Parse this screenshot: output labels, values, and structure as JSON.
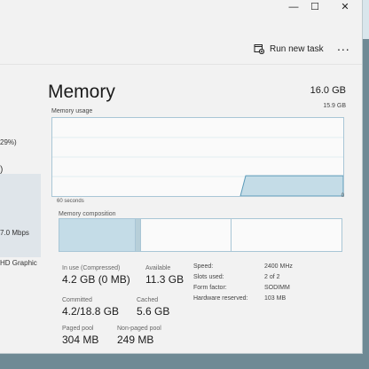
{
  "window": {
    "controls": {
      "minimize": "—",
      "maximize": "☐",
      "close": "✕"
    }
  },
  "toolbar": {
    "run_new_task": "Run new task",
    "more": "..."
  },
  "sidebar": {
    "items": [
      {
        "label": "29%)"
      },
      {
        "label": ")"
      },
      {
        "label": "7.0 Mbps"
      },
      {
        "label": "HD Graphic"
      }
    ]
  },
  "memory": {
    "title": "Memory",
    "total": "16.0 GB",
    "usage_graph": {
      "label": "Memory usage",
      "max_label": "15.9 GB",
      "time_left_label": "60 seconds",
      "time_right_label": "0",
      "recent_usage_fraction": 0.26
    },
    "composition": {
      "label": "Memory composition",
      "in_use_fraction": 0.27,
      "modified_fraction": 0.02,
      "standby_fraction": 0.32,
      "free_fraction": 0.39
    },
    "stats": {
      "in_use": {
        "label": "In use (Compressed)",
        "value": "4.2 GB (0 MB)"
      },
      "available": {
        "label": "Available",
        "value": "11.3 GB"
      },
      "committed": {
        "label": "Committed",
        "value": "4.2/18.8 GB"
      },
      "cached": {
        "label": "Cached",
        "value": "5.6 GB"
      },
      "paged_pool": {
        "label": "Paged pool",
        "value": "304 MB"
      },
      "non_paged_pool": {
        "label": "Non-paged pool",
        "value": "249 MB"
      }
    },
    "specs": {
      "speed": {
        "label": "Speed:",
        "value": "2400 MHz"
      },
      "slots": {
        "label": "Slots used:",
        "value": "2 of 2"
      },
      "form_factor": {
        "label": "Form factor:",
        "value": "SODIMM"
      },
      "hardware_reserved": {
        "label": "Hardware reserved:",
        "value": "103 MB"
      }
    }
  },
  "colors": {
    "graph_border": "#a9c6d6",
    "graph_fill": "#c4dce7",
    "window_bg": "#f2f2f2",
    "desktop_bg": "#6f8a95"
  }
}
